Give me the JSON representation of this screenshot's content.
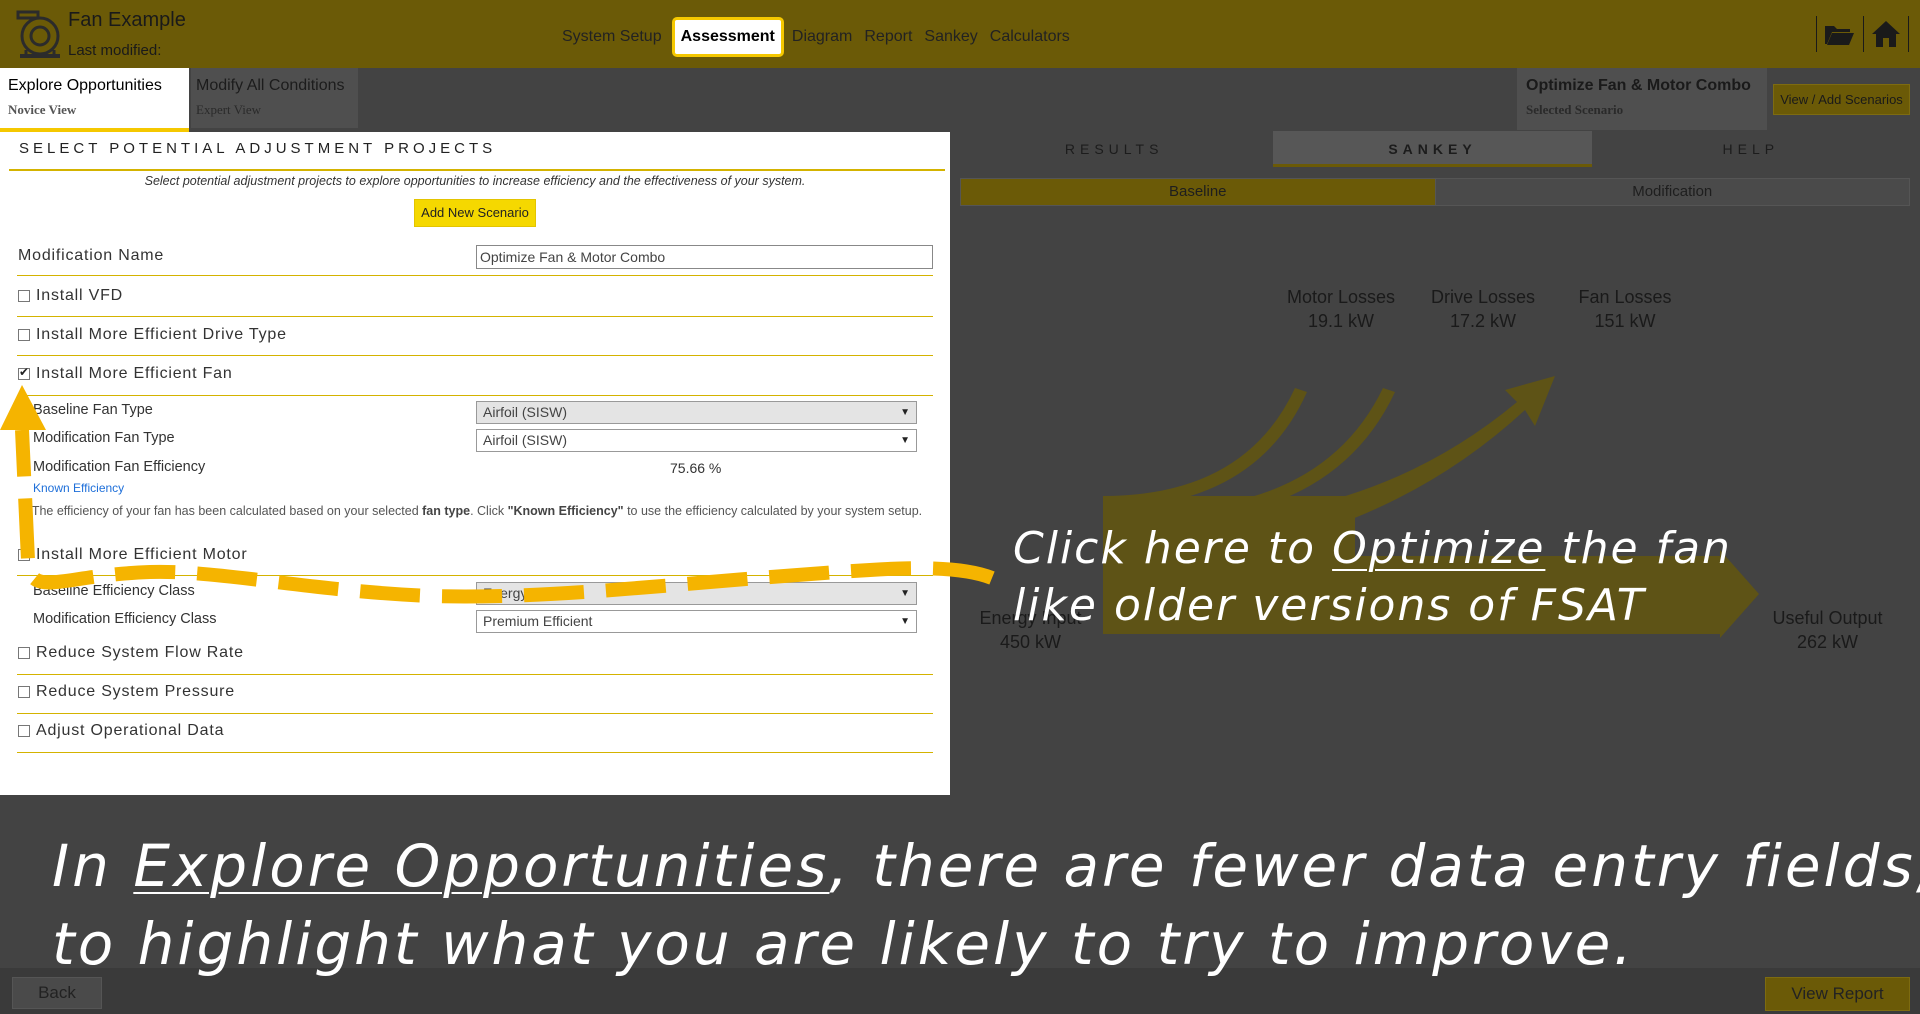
{
  "header": {
    "title": "Fan Example",
    "subtitle": "Last modified:",
    "nav": [
      "System Setup",
      "Assessment",
      "Diagram",
      "Report",
      "Sankey",
      "Calculators"
    ],
    "active_nav": "Assessment",
    "icons": [
      "folder-open-icon",
      "home-icon"
    ]
  },
  "tabs": {
    "explore": {
      "title": "Explore Opportunities",
      "sub": "Novice View"
    },
    "modify": {
      "title": "Modify All Conditions",
      "sub": "Expert View"
    }
  },
  "scenario": {
    "title": "Optimize Fan & Motor Combo",
    "sub": "Selected Scenario",
    "button": "View / Add Scenarios"
  },
  "form": {
    "heading": "SELECT POTENTIAL ADJUSTMENT PROJECTS",
    "description": "Select potential adjustment projects to explore opportunities to increase efficiency and the effectiveness of your system.",
    "add_button": "Add New Scenario",
    "modification_name_label": "Modification Name",
    "modification_name_value": "Optimize Fan & Motor Combo",
    "projects": [
      {
        "label": "Install VFD",
        "checked": false
      },
      {
        "label": "Install More Efficient Drive Type",
        "checked": false
      },
      {
        "label": "Install More Efficient Fan",
        "checked": true
      },
      {
        "label": "Install More Efficient Motor",
        "checked": false
      },
      {
        "label": "Reduce System Flow Rate",
        "checked": false
      },
      {
        "label": "Reduce System Pressure",
        "checked": false
      },
      {
        "label": "Adjust Operational Data",
        "checked": false
      }
    ],
    "fan": {
      "baseline_type_label": "Baseline Fan Type",
      "baseline_type_value": "Airfoil (SISW)",
      "mod_type_label": "Modification Fan Type",
      "mod_type_value": "Airfoil (SISW)",
      "mod_eff_label": "Modification Fan Efficiency",
      "mod_eff_value": "75.66 %",
      "known_eff_link": "Known Efficiency",
      "note_pre": "The efficiency of your fan has been calculated based on your selected ",
      "note_bold1": "fan type",
      "note_mid": ". Click ",
      "note_bold2": "\"Known Efficiency\"",
      "note_post": " to use the efficiency calculated by your system setup."
    },
    "motor": {
      "baseline_class_label": "Baseline Efficiency Class",
      "baseline_class_value": "Energy Efficient",
      "mod_class_label": "Modification Efficiency Class",
      "mod_class_value": "Premium Efficient"
    }
  },
  "results": {
    "tabs": [
      "RESULTS",
      "SANKEY",
      "HELP"
    ],
    "active_tab": "SANKEY",
    "toggle": [
      "Baseline",
      "Modification"
    ],
    "active_toggle": "Baseline",
    "sankey": {
      "motor_losses": {
        "label": "Motor Losses",
        "value": "19.1 kW"
      },
      "drive_losses": {
        "label": "Drive Losses",
        "value": "17.2 kW"
      },
      "fan_losses": {
        "label": "Fan Losses",
        "value": "151 kW"
      },
      "energy_input": {
        "label": "Energy Input",
        "value": "450 kW"
      },
      "useful_output": {
        "label": "Useful Output",
        "value": "262 kW"
      }
    }
  },
  "bottom": {
    "back": "Back",
    "view_report": "View Report"
  },
  "annotations": {
    "optimize_line1_pre": "Click here to ",
    "optimize_line1_u": "Optimize",
    "optimize_line1_post": " the fan",
    "optimize_line2": "like older versions of FSAT",
    "explore_line1_pre": "In ",
    "explore_line1_u": "Explore Opportunities",
    "explore_line1_post": ", there are fewer data entry fields,",
    "explore_line2": "to highlight what you are likely to try to improve."
  },
  "colors": {
    "accent": "#f5c800",
    "header_dimmed": "#6b5a07",
    "overlay_dim": "#434343",
    "arrow": "#f5b400"
  }
}
